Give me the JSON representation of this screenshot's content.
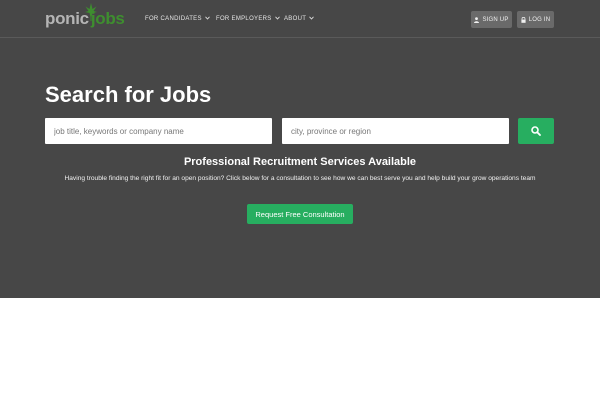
{
  "brand": {
    "part1": "ponic",
    "part2": "jobs"
  },
  "nav": {
    "items": [
      {
        "label": "FOR CANDIDATES"
      },
      {
        "label": "FOR EMPLOYERS"
      },
      {
        "label": "ABOUT"
      }
    ],
    "sign_up": "SIGN UP",
    "log_in": "LOG IN"
  },
  "hero": {
    "title": "Search for Jobs",
    "keyword_placeholder": "job title, keywords or company name",
    "location_placeholder": "city, province or region",
    "subheading": "Professional Recruitment Services Available",
    "description": "Having trouble finding the right fit for an open position? Click below for a consultation to see how we can best serve you and help build your grow operations team",
    "cta_label": "Request Free Consultation"
  },
  "colors": {
    "hero_bg": "#474747",
    "accent": "#27ae60",
    "logo_gray": "#b5b5b5",
    "logo_green": "#3e8e2f"
  }
}
